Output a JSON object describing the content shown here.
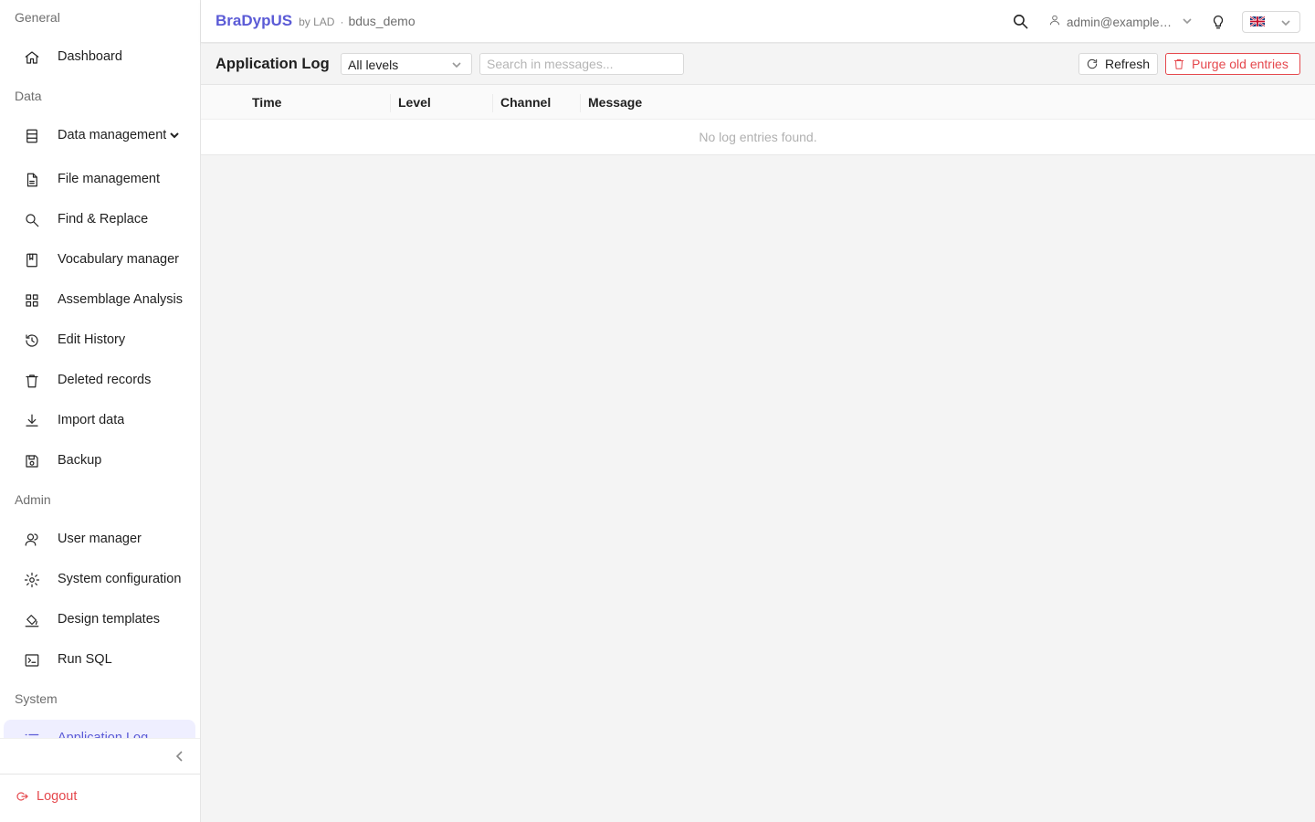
{
  "colors": {
    "accent": "#5b5bd6",
    "danger": "#e5484d",
    "active_bg": "#efefff",
    "muted_text": "#6e6e6e"
  },
  "header": {
    "brand": "BraDypUS",
    "by": "by LAD",
    "separator": "·",
    "app_name": "bdus_demo",
    "user": "admin@example.com",
    "language_flag": "uk-flag"
  },
  "sidebar": {
    "groups": [
      {
        "title": "General"
      },
      {
        "title": "Data"
      },
      {
        "title": "Admin"
      },
      {
        "title": "System"
      }
    ],
    "items": [
      {
        "label": "Dashboard",
        "icon": "home-icon"
      },
      {
        "label": "Data management",
        "icon": "database-icon",
        "expandable": true
      },
      {
        "label": "File management",
        "icon": "file-icon"
      },
      {
        "label": "Find & Replace",
        "icon": "search-icon"
      },
      {
        "label": "Vocabulary manager",
        "icon": "book-icon"
      },
      {
        "label": "Assemblage Analysis",
        "icon": "grid-icon"
      },
      {
        "label": "Edit History",
        "icon": "history-icon"
      },
      {
        "label": "Deleted records",
        "icon": "trash-icon"
      },
      {
        "label": "Import data",
        "icon": "download-icon"
      },
      {
        "label": "Backup",
        "icon": "save-icon"
      },
      {
        "label": "User manager",
        "icon": "users-icon"
      },
      {
        "label": "System configuration",
        "icon": "gear-icon"
      },
      {
        "label": "Design templates",
        "icon": "paint-bucket-icon"
      },
      {
        "label": "Run SQL",
        "icon": "terminal-icon"
      },
      {
        "label": "Application Log",
        "icon": "list-icon",
        "active": true
      }
    ],
    "logout_label": "Logout"
  },
  "toolbar": {
    "title": "Application Log",
    "level_filter": "All levels",
    "search_placeholder": "Search in messages...",
    "refresh_label": "Refresh",
    "purge_label": "Purge old entries"
  },
  "table": {
    "columns": [
      "Time",
      "Level",
      "Channel",
      "Message"
    ],
    "rows": [],
    "empty_text": "No log entries found."
  }
}
